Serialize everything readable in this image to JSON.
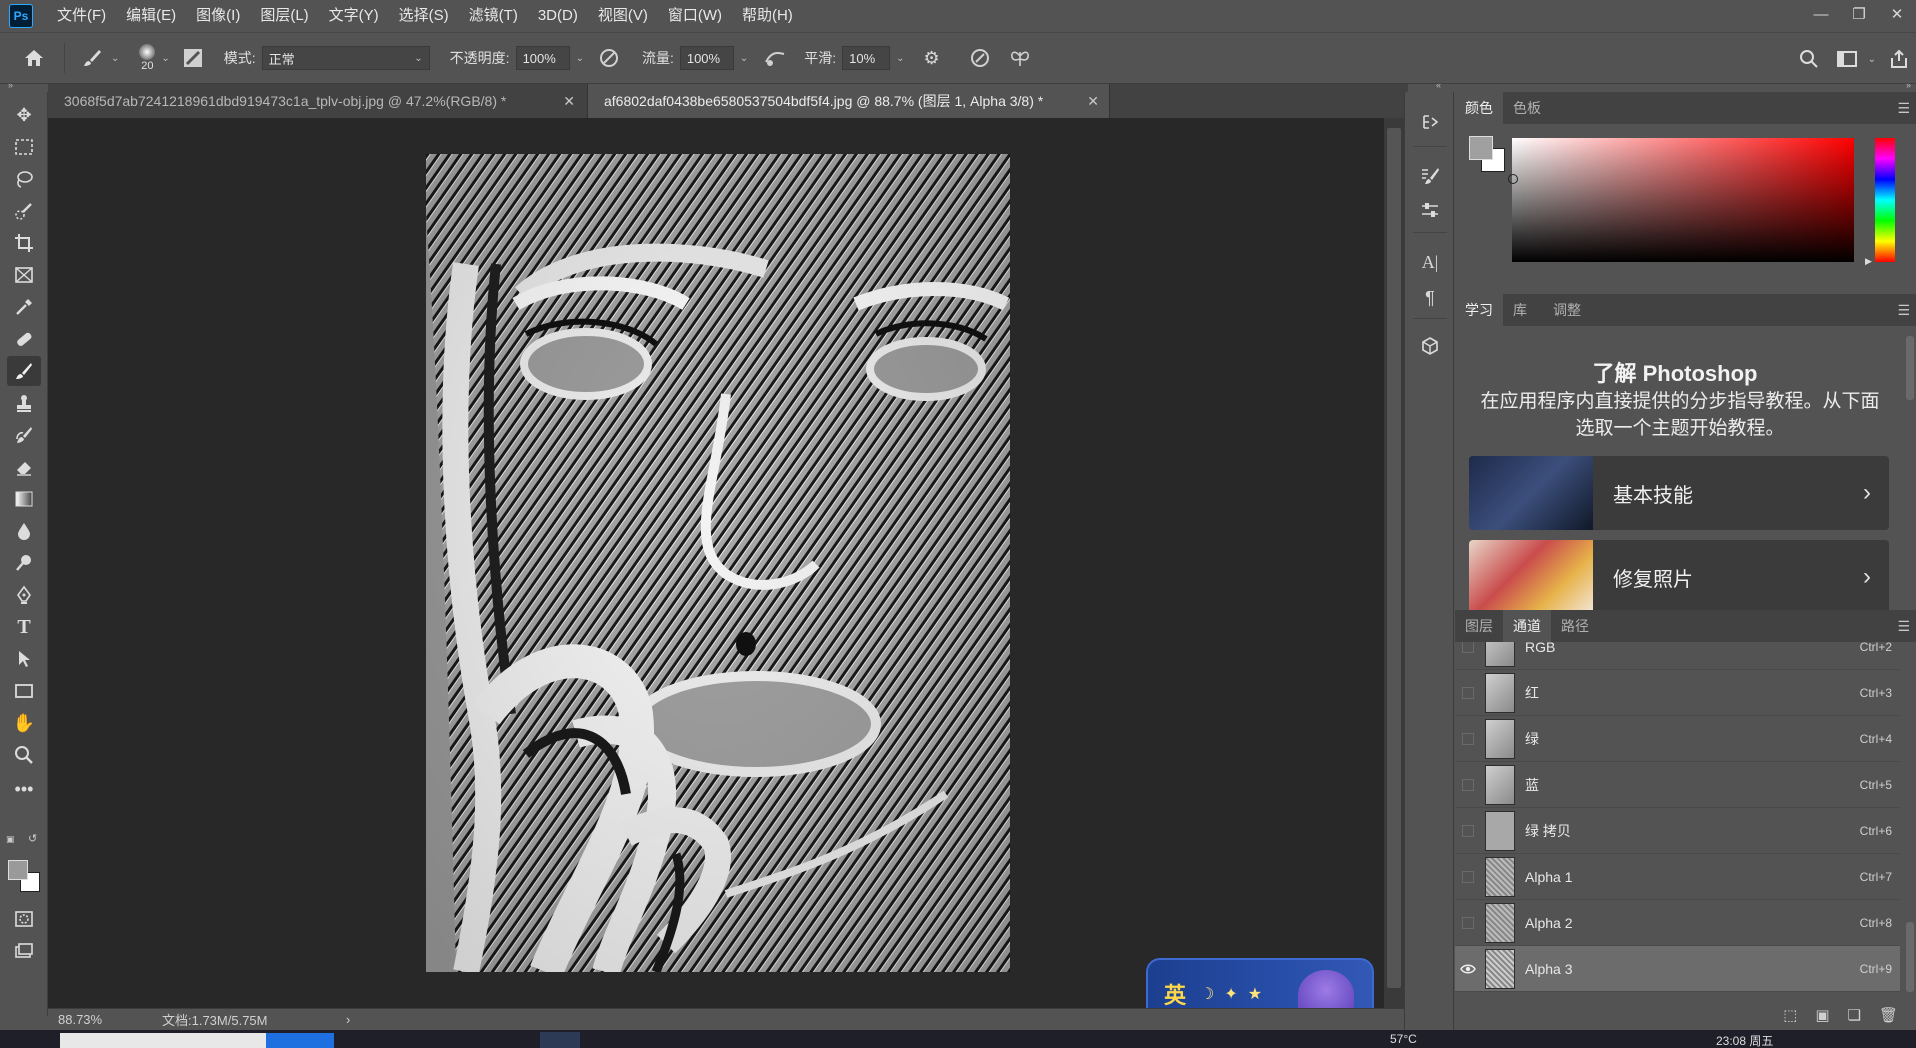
{
  "menubar": {
    "logo": "Ps",
    "items": [
      "文件(F)",
      "编辑(E)",
      "图像(I)",
      "图层(L)",
      "文字(Y)",
      "选择(S)",
      "滤镜(T)",
      "3D(D)",
      "视图(V)",
      "窗口(W)",
      "帮助(H)"
    ],
    "window_controls": [
      "minimize-icon",
      "restore-icon",
      "close-icon"
    ]
  },
  "options": {
    "brush_size": "20",
    "mode_label": "模式:",
    "mode_value": "正常",
    "opacity_label": "不透明度:",
    "opacity_value": "100%",
    "flow_label": "流量:",
    "flow_value": "100%",
    "smooth_label": "平滑:",
    "smooth_value": "10%"
  },
  "tabs": [
    {
      "label": "3068f5d7ab7241218961dbd919473c1a_tplv-obj.jpg @ 47.2%(RGB/8) *",
      "active": false
    },
    {
      "label": "af6802daf0438be6580537504bdf5f4.jpg  @ 88.7% (图层 1, Alpha 3/8) *",
      "active": true
    }
  ],
  "status": {
    "zoom": "88.73%",
    "doc": "文档:1.73M/5.75M",
    "arrow": "›"
  },
  "color_panel": {
    "tabs": [
      "颜色",
      "色板"
    ]
  },
  "learn_panel": {
    "tabs": [
      "学习",
      "库",
      "调整"
    ],
    "title": "了解 Photoshop",
    "description": "在应用程序内直接提供的分步指导教程。从下面选取一个主题开始教程。",
    "cards": [
      {
        "label": "基本技能"
      },
      {
        "label": "修复照片"
      }
    ]
  },
  "channels_panel": {
    "tabs": [
      "图层",
      "通道",
      "路径"
    ],
    "rows": [
      {
        "name": "RGB",
        "shortcut": "Ctrl+2",
        "visible": false,
        "selected": false
      },
      {
        "name": "红",
        "shortcut": "Ctrl+3",
        "visible": false,
        "selected": false
      },
      {
        "name": "绿",
        "shortcut": "Ctrl+4",
        "visible": false,
        "selected": false
      },
      {
        "name": "蓝",
        "shortcut": "Ctrl+5",
        "visible": false,
        "selected": false
      },
      {
        "name": "绿 拷贝",
        "shortcut": "Ctrl+6",
        "visible": false,
        "selected": false
      },
      {
        "name": "Alpha 1",
        "shortcut": "Ctrl+7",
        "visible": false,
        "selected": false
      },
      {
        "name": "Alpha 2",
        "shortcut": "Ctrl+8",
        "visible": false,
        "selected": false
      },
      {
        "name": "Alpha 3",
        "shortcut": "Ctrl+9",
        "visible": true,
        "selected": true
      }
    ]
  },
  "ime": {
    "char": "英"
  },
  "taskbar": {
    "temp": "57°C",
    "time": "23:08 周五"
  }
}
